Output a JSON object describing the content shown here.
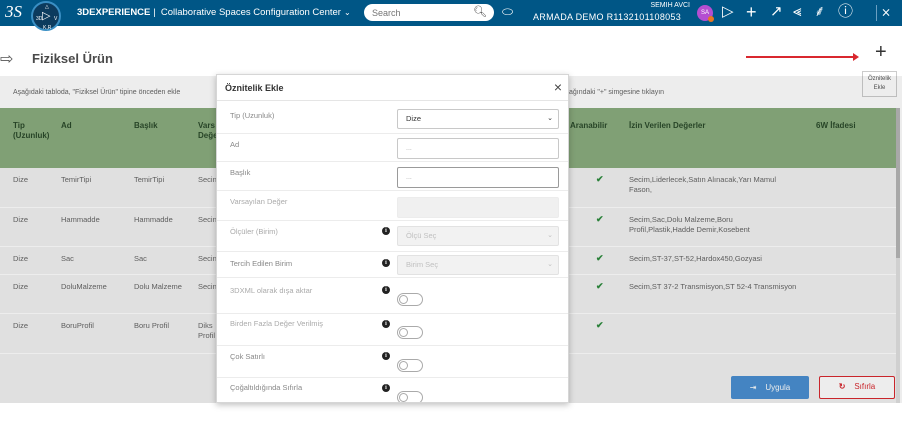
{
  "topbar": {
    "logo": "3S",
    "compass": {
      "north": "△",
      "left": "3D",
      "right": "V",
      "bottom": "K,R",
      "center": "▷"
    },
    "brand": "3DEXPERIENCE",
    "brand_sep": "|",
    "app_name": "Collaborative Spaces Configuration Center",
    "app_chevron": "⌄",
    "search_placeholder": "Search",
    "user_name": "SEMIH AVCI",
    "tenant": "ARMADA DEMO R1132101108053",
    "avatar_initials": "SA"
  },
  "page": {
    "title": "Fiziksel Ürün",
    "add_tooltip_line1": "Öznitelik",
    "add_tooltip_line2": "Ekle",
    "info_text": "Aşağıdaki tabloda, \"Fiziksel Ürün\" tipine önceden ekle",
    "info_text_right": "ağındaki \"+\" simgesine tıklayın"
  },
  "table": {
    "headers": {
      "tip": "Tip (Uzunluk)",
      "ad": "Ad",
      "baslik": "Başlık",
      "vars": "Vars Değe",
      "aranabilir": "Aranabilir",
      "izin": "İzin Verilen Değerler",
      "ifade": "6W İfadesi"
    },
    "rows": [
      {
        "tip": "Dize",
        "ad": "TemirTipi",
        "baslik": "TemirTipi",
        "vars": "Secin",
        "aranabilir": "✔",
        "izin": "Secim,Liderlecek,Satın Alınacak,Yarı Mamul Fason,"
      },
      {
        "tip": "Dize",
        "ad": "Hammadde",
        "baslik": "Hammadde",
        "vars": "Secin",
        "aranabilir": "✔",
        "izin": "Secim,Sac,Dolu Malzeme,Boru Profil,Plastik,Hadde Demir,Kosebent"
      },
      {
        "tip": "Dize",
        "ad": "Sac",
        "baslik": "Sac",
        "vars": "Secin",
        "aranabilir": "✔",
        "izin": "Secim,ST-37,ST-52,Hardox450,Gozyasi"
      },
      {
        "tip": "Dize",
        "ad": "DoluMalzeme",
        "baslik": "Dolu Malzeme",
        "vars": "Secin",
        "aranabilir": "✔",
        "izin": "Secim,ST 37-2 Transmisyon,ST 52-4 Transmisyon"
      },
      {
        "tip": "Dize",
        "ad": "BoruProfil",
        "baslik": "Boru Profil",
        "vars": "Diks Profil",
        "aranabilir": "✔",
        "izin": ""
      }
    ]
  },
  "actions": {
    "apply": "Uygula",
    "cancel": "Sıfırla"
  },
  "modal": {
    "title": "Öznitelik Ekle",
    "close": "×",
    "fields": {
      "tip_label": "Tip (Uzunluk)",
      "tip_value": "Dize",
      "ad_label": "Ad",
      "ad_placeholder": "...",
      "baslik_label": "Başlık",
      "baslik_placeholder": "...",
      "varsayilan_label": "Varsayılan Değer",
      "olcu_label": "Ölçüler (Birim)",
      "olcu_value": "Ölçü Seç",
      "tercih_label": "Tercih Edilen Birim",
      "tercih_value": "Birim Seç",
      "xml_label": "3DXML olarak dışa aktar",
      "birden_label": "Birden Fazla Değer Verilmiş",
      "cok_label": "Çok Satırlı",
      "cogaltildi_label": "Çoğaltıldığında Sıfırla"
    }
  }
}
